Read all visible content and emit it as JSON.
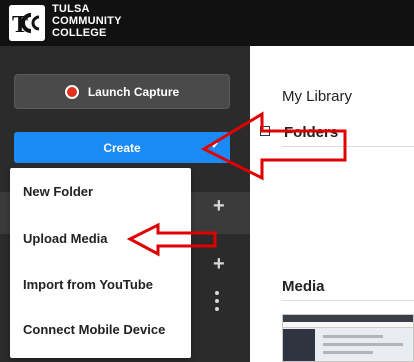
{
  "brand": {
    "lines": [
      "TULSA",
      "COMMUNITY",
      "COLLEGE"
    ]
  },
  "sidebar": {
    "launch_label": "Launch Capture",
    "create_label": "Create"
  },
  "menu": {
    "items": [
      "New Folder",
      "Upload Media",
      "Import from YouTube",
      "Connect Mobile Device"
    ]
  },
  "main": {
    "title": "My Library",
    "folders_label": "Folders",
    "media_label": "Media"
  },
  "colors": {
    "accent": "#1a8af5",
    "annotation": "#e00000"
  }
}
